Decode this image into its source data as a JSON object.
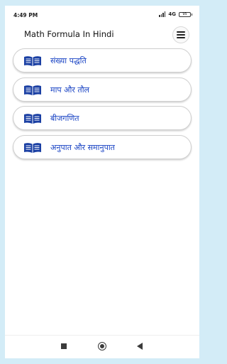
{
  "status_bar": {
    "time": "4:49 PM",
    "network": "4G",
    "battery": "95"
  },
  "app_bar": {
    "title": "Math Formula In Hindi",
    "menu_icon": "hamburger-menu-icon"
  },
  "topics": [
    {
      "label": "संख्या पद्धति",
      "icon": "open-book-icon"
    },
    {
      "label": "माप और तौल",
      "icon": "open-book-icon"
    },
    {
      "label": "बीजगणित",
      "icon": "open-book-icon"
    },
    {
      "label": "अनुपात और समानुपात",
      "icon": "open-book-icon"
    }
  ],
  "colors": {
    "accent": "#1a44c4",
    "background": "#d3ecf7"
  }
}
